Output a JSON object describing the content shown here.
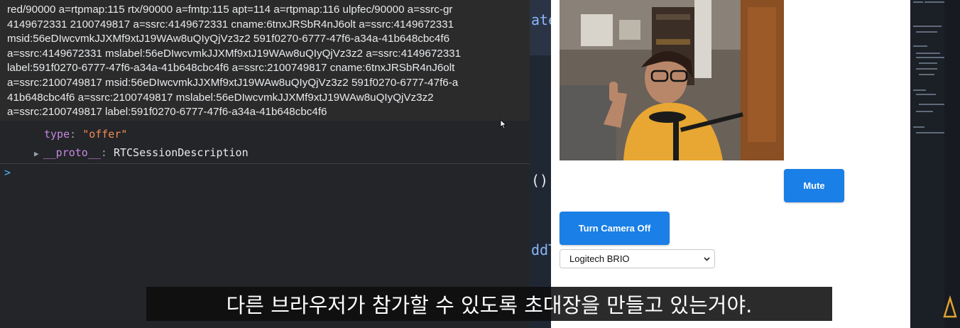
{
  "console": {
    "tooltip_lines": [
      "red/90000 a=rtpmap:115 rtx/90000 a=fmtp:115 apt=114 a=rtpmap:116 ulpfec/90000 a=ssrc-gr",
      "4149672331 2100749817 a=ssrc:4149672331 cname:6tnxJRSbR4nJ6olt a=ssrc:4149672331",
      "msid:56eDIwcvmkJJXMf9xtJ19WAw8uQIyQjVz3z2 591f0270-6777-47f6-a34a-41b648cbc4f6",
      "a=ssrc:4149672331 mslabel:56eDIwcvmkJJXMf9xtJ19WAw8uQIyQjVz3z2 a=ssrc:4149672331",
      "label:591f0270-6777-47f6-a34a-41b648cbc4f6 a=ssrc:2100749817 cname:6tnxJRSbR4nJ6olt",
      "a=ssrc:2100749817 msid:56eDIwcvmkJJXMf9xtJ19WAw8uQIyQjVz3z2 591f0270-6777-47f6-a",
      "41b648cbc4f6 a=ssrc:2100749817 mslabel:56eDIwcvmkJJXMf9xtJ19WAw8uQIyQjVz3z2",
      "a=ssrc:2100749817 label:591f0270-6777-47f6-a34a-41b648cbc4f6"
    ],
    "type_key": "type",
    "type_value": "\"offer\"",
    "proto_key": "__proto__",
    "proto_value": "RTCSessionDescription",
    "prompt": ">"
  },
  "editor": {
    "fragments": [
      "ate",
      "()",
      "ddT"
    ]
  },
  "page": {
    "mute_label": "Mute",
    "camera_label": "Turn Camera Off",
    "camera_select": "Logitech BRIO"
  },
  "subtitle": "다른 브라우저가 참가할 수 있도록 초대장을 만들고 있는거야.",
  "colors": {
    "accent": "#1a7fe6",
    "console_bg": "#242528",
    "string": "#f28b54",
    "key": "#c587e0"
  }
}
